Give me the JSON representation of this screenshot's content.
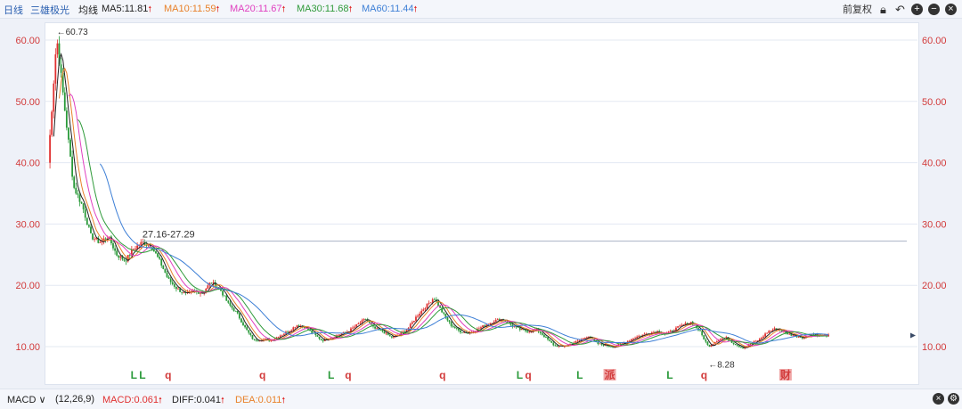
{
  "header": {
    "period": "日线",
    "indicator": "三雄极光",
    "ma_label": "均线",
    "ma5": "MA5:11.81",
    "ma10": "MA10:11.59",
    "ma20": "MA20:11.67",
    "ma30": "MA30:11.68",
    "ma60": "MA60:11.44",
    "adjust": "前复权",
    "colors": {
      "ma5": "#222222",
      "ma10": "#e8812a",
      "ma20": "#e040c0",
      "ma30": "#2f9a3a",
      "ma60": "#3d7fd6"
    }
  },
  "footer": {
    "macd_name": "MACD",
    "params": "(12,26,9)",
    "macd": "MACD:0.061",
    "diff": "DIFF:0.041",
    "dea": "DEA:0.011"
  },
  "chart_data": {
    "type": "candlestick",
    "ylim": [
      8,
      62
    ],
    "yticks": [
      10,
      20,
      30,
      40,
      50,
      60
    ],
    "ytick_labels": [
      "10.00",
      "20.00",
      "30.00",
      "40.00",
      "50.00",
      "60.00"
    ],
    "annotations": {
      "high": "←60.73",
      "low": "←8.28",
      "range_line": "27.16-27.29",
      "range_value": 27.2
    },
    "close_path": [
      [
        0,
        40
      ],
      [
        2,
        60.5
      ],
      [
        4,
        48
      ],
      [
        6,
        36
      ],
      [
        8,
        33
      ],
      [
        10,
        28
      ],
      [
        12,
        27
      ],
      [
        14,
        28
      ],
      [
        16,
        25
      ],
      [
        18,
        24
      ],
      [
        20,
        26
      ],
      [
        22,
        27
      ],
      [
        24,
        26.5
      ],
      [
        26,
        24
      ],
      [
        28,
        21
      ],
      [
        30,
        19.5
      ],
      [
        32,
        18.5
      ],
      [
        34,
        19
      ],
      [
        36,
        18.8
      ],
      [
        38,
        20.5
      ],
      [
        40,
        19.5
      ],
      [
        42,
        17
      ],
      [
        44,
        15.5
      ],
      [
        46,
        13
      ],
      [
        48,
        11
      ],
      [
        50,
        11.2
      ],
      [
        52,
        11
      ],
      [
        54,
        11.8
      ],
      [
        56,
        12.5
      ],
      [
        58,
        13.5
      ],
      [
        60,
        13.2
      ],
      [
        62,
        12
      ],
      [
        64,
        11
      ],
      [
        66,
        11.5
      ],
      [
        68,
        12
      ],
      [
        70,
        12.5
      ],
      [
        72,
        13.5
      ],
      [
        74,
        14.5
      ],
      [
        76,
        13
      ],
      [
        78,
        12.5
      ],
      [
        80,
        11.5
      ],
      [
        82,
        12
      ],
      [
        84,
        13
      ],
      [
        86,
        15
      ],
      [
        88,
        16.5
      ],
      [
        90,
        18
      ],
      [
        92,
        15.5
      ],
      [
        94,
        13.5
      ],
      [
        96,
        12.5
      ],
      [
        98,
        12.2
      ],
      [
        100,
        12.8
      ],
      [
        102,
        13.5
      ],
      [
        104,
        14.2
      ],
      [
        106,
        14.5
      ],
      [
        108,
        13.5
      ],
      [
        110,
        12.8
      ],
      [
        112,
        12.5
      ],
      [
        114,
        12.8
      ],
      [
        116,
        11.5
      ],
      [
        118,
        10.2
      ],
      [
        120,
        10
      ],
      [
        122,
        10.5
      ],
      [
        124,
        11
      ],
      [
        126,
        11.8
      ],
      [
        128,
        10.5
      ],
      [
        130,
        10.2
      ],
      [
        132,
        10
      ],
      [
        134,
        10.5
      ],
      [
        136,
        11.2
      ],
      [
        138,
        11.8
      ],
      [
        140,
        12.2
      ],
      [
        142,
        12.5
      ],
      [
        144,
        12
      ],
      [
        146,
        12.8
      ],
      [
        148,
        13.5
      ],
      [
        150,
        14
      ],
      [
        152,
        12.5
      ],
      [
        154,
        10
      ],
      [
        156,
        11
      ],
      [
        158,
        11.5
      ],
      [
        160,
        10.5
      ],
      [
        162,
        9.8
      ],
      [
        164,
        10.5
      ],
      [
        166,
        11.2
      ],
      [
        168,
        12.5
      ],
      [
        170,
        13
      ],
      [
        172,
        12.2
      ],
      [
        174,
        11.8
      ],
      [
        176,
        11.5
      ],
      [
        178,
        12
      ],
      [
        180,
        11.8
      ],
      [
        182,
        11.81
      ]
    ],
    "signals": [
      {
        "label": "L",
        "x": 20
      },
      {
        "label": "L",
        "x": 22
      },
      {
        "label": "q",
        "x": 28
      },
      {
        "label": "q",
        "x": 50
      },
      {
        "label": "L",
        "x": 66
      },
      {
        "label": "q",
        "x": 70
      },
      {
        "label": "q",
        "x": 92
      },
      {
        "label": "L",
        "x": 110
      },
      {
        "label": "q",
        "x": 112
      },
      {
        "label": "L",
        "x": 124
      },
      {
        "label": "派",
        "x": 131
      },
      {
        "label": "L",
        "x": 145
      },
      {
        "label": "q",
        "x": 153
      },
      {
        "label": "财",
        "x": 172
      }
    ]
  }
}
